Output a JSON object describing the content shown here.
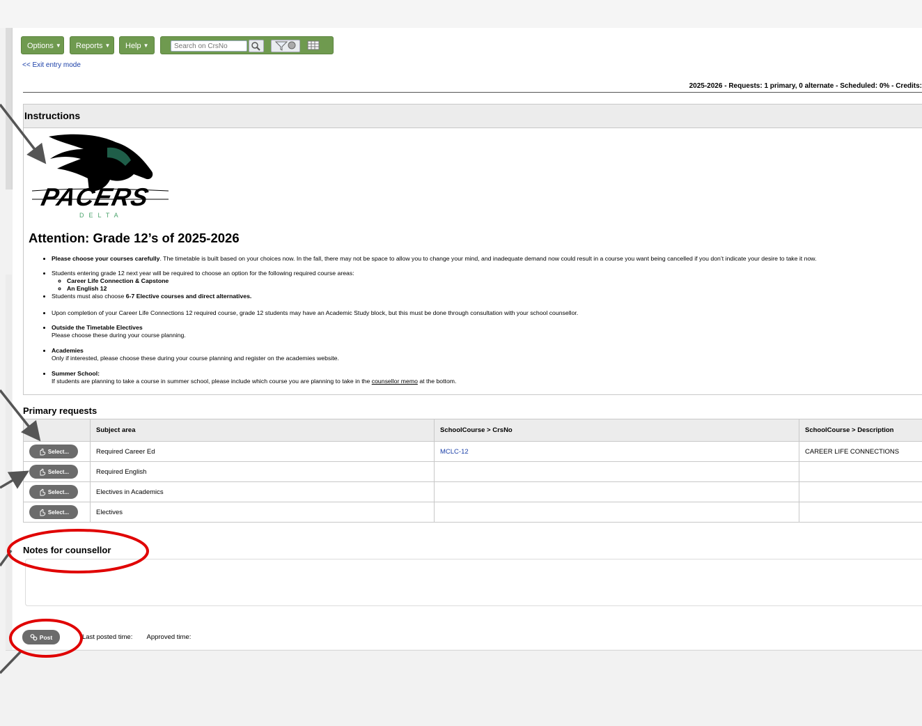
{
  "toolbar": {
    "options_label": "Options",
    "reports_label": "Reports",
    "help_label": "Help",
    "search_placeholder": "Search on CrsNo",
    "search_icon": "magnifier-icon",
    "filter_icon": "filter-icon",
    "grid_icon": "grid-icon"
  },
  "exit_link": "<< Exit entry mode",
  "summary": "2025-2026 - Requests: 1 primary, 0 alternate - Scheduled: 0% - Credits:",
  "instructions": {
    "title": "Instructions",
    "logo_text": "PACERS",
    "logo_subtext": "DELTA",
    "heading": "Attention: Grade 12’s of 2025-2026",
    "items": {
      "i1_bold": "Please choose your courses carefully",
      "i1_text": ". The timetable is built based on your choices now.   In the fall, there may not be space to allow you to change your mind, and inadequate demand now could result in a course you want being cancelled if you don’t indicate your desire to take it now.",
      "i2_text": "Students entering grade 12 next year will be required to choose an option for the following required course areas:",
      "i2_sub1": "Career Life Connection & Capstone",
      "i2_sub2": "An English 12",
      "i3_text": "Students must also choose ",
      "i3_bold": "6-7 Elective courses and direct alternatives.",
      "i4_text": "Upon completion of your Career Life Connections 12 required course, grade 12 students may have an Academic Study block, but this must be done through consultation with your school counsellor.",
      "i5_title": "Outside the Timetable Electives",
      "i5_text": "Please choose these during your course planning.",
      "i6_title": "Academies",
      "i6_text": "Only if interested, please choose these during your course planning and register on the academies website.",
      "i7_title": "Summer School:",
      "i7_text_a": "If students are planning to take a course in summer school, please include which course you are planning to take in the ",
      "i7_link": "counsellor memo",
      "i7_text_b": " at the bottom."
    }
  },
  "primary_requests": {
    "title": "Primary requests",
    "columns": [
      "",
      "Subject area",
      "SchoolCourse > CrsNo",
      "SchoolCourse > Description"
    ],
    "select_label": "Select...",
    "rows": [
      {
        "subject": "Required Career Ed",
        "crsno": "MCLC-12",
        "description": "CAREER LIFE CONNECTIONS"
      },
      {
        "subject": "Required English",
        "crsno": "",
        "description": ""
      },
      {
        "subject": "Electives in Academics",
        "crsno": "",
        "description": ""
      },
      {
        "subject": "Electives",
        "crsno": "",
        "description": ""
      }
    ]
  },
  "notes": {
    "title": "Notes for counsellor",
    "value": ""
  },
  "post": {
    "label": "Post",
    "last_posted": "Last posted time:",
    "approved": "Approved time:"
  },
  "colors": {
    "toolbar_green": "#6f9a4f",
    "button_gray": "#6b6b6b",
    "annotation_red": "#e00000",
    "arrow_gray": "#555555",
    "link_blue": "#1a3fa8"
  }
}
